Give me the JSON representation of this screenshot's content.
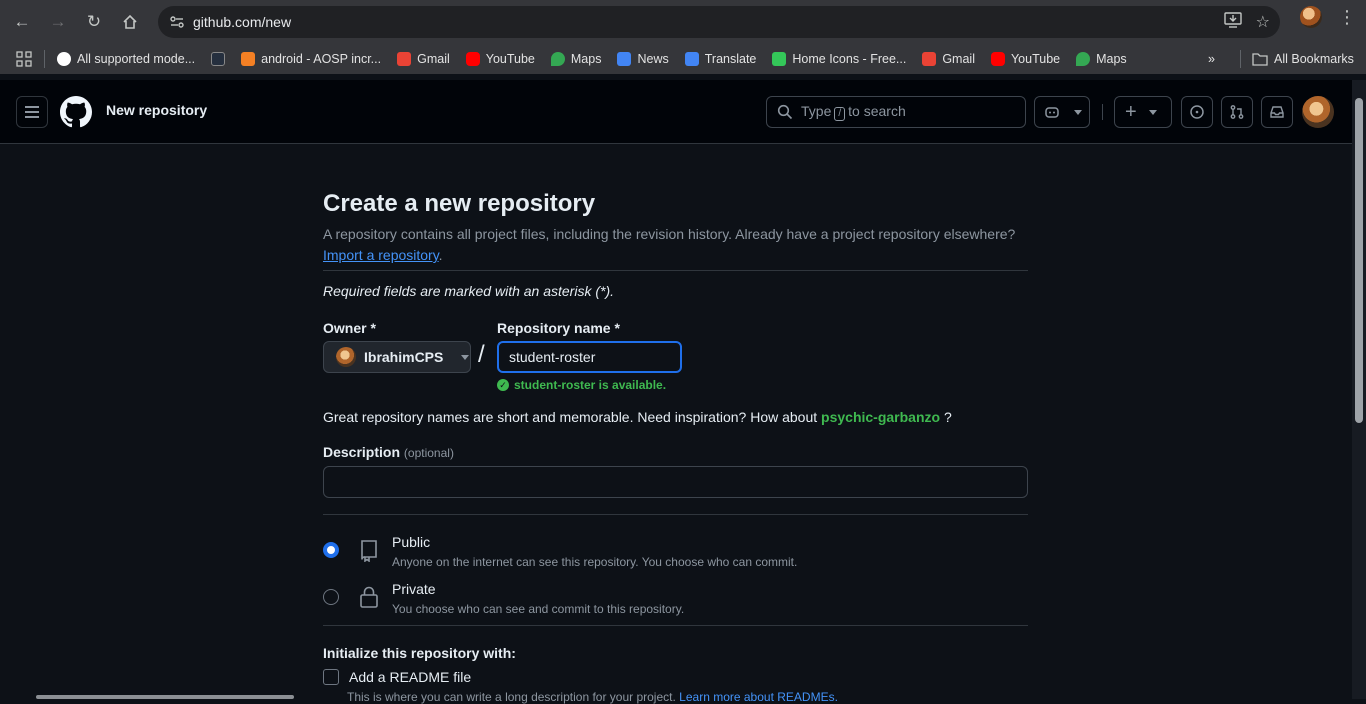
{
  "browser": {
    "url": "github.com/new",
    "bookmarks": [
      {
        "label": "All supported mode...",
        "color": "#ffffff"
      },
      {
        "label": "",
        "color": "#252f3e"
      },
      {
        "label": "android - AOSP incr...",
        "color": "#f48024"
      },
      {
        "label": "Gmail",
        "color": "#ea4335"
      },
      {
        "label": "YouTube",
        "color": "#ff0000"
      },
      {
        "label": "Maps",
        "color": "#34a853"
      },
      {
        "label": "News",
        "color": "#4285f4"
      },
      {
        "label": "Translate",
        "color": "#4285f4"
      },
      {
        "label": "Home Icons - Free...",
        "color": "#34c759"
      },
      {
        "label": "Gmail",
        "color": "#ea4335"
      },
      {
        "label": "YouTube",
        "color": "#ff0000"
      },
      {
        "label": "Maps",
        "color": "#34a853"
      }
    ],
    "all_bookmarks": "All Bookmarks"
  },
  "header": {
    "title": "New repository",
    "search_type": "Type",
    "search_key": "/",
    "search_suffix": "to search"
  },
  "form": {
    "title": "Create a new repository",
    "subtitle": "A repository contains all project files, including the revision history. Already have a project repository elsewhere?",
    "import_link": "Import a repository",
    "import_suffix": ".",
    "required_note": "Required fields are marked with an asterisk (*).",
    "owner_label": "Owner *",
    "owner_value": "IbrahimCPS",
    "repo_label": "Repository name *",
    "repo_value": "student-roster",
    "available_msg": "student-roster is available.",
    "inspire_text": "Great repository names are short and memorable. Need inspiration? How about",
    "suggestion": "psychic-garbanzo",
    "inspire_end": "?",
    "desc_label": "Description",
    "desc_optional": "(optional)",
    "public_title": "Public",
    "public_desc": "Anyone on the internet can see this repository. You choose who can commit.",
    "private_title": "Private",
    "private_desc": "You choose who can see and commit to this repository.",
    "init_label": "Initialize this repository with:",
    "readme_label": "Add a README file",
    "readme_help": "This is where you can write a long description for your project.",
    "readme_help_link": "Learn more about READMEs."
  },
  "colors": {
    "accent": "#1f6feb",
    "success": "#3fb950",
    "link": "#4493f8"
  }
}
